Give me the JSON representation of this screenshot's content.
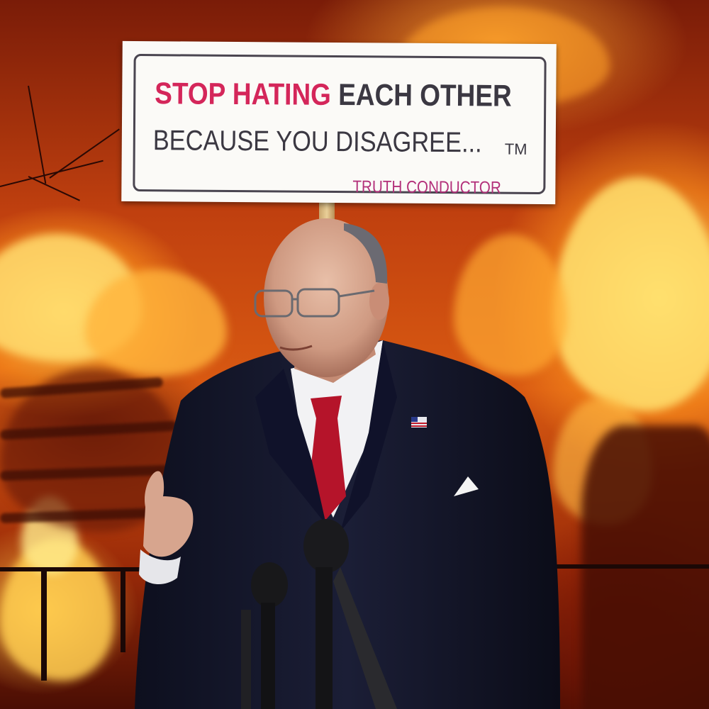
{
  "sign": {
    "line1_part1": "STOP HATING",
    "line1_part2": "EACH OTHER",
    "line2": "BECAUSE YOU DISAGREE...",
    "trademark": "TM",
    "footer": "TRUTH CONDUCTOR"
  },
  "colors": {
    "fire_bright": "#ffd65a",
    "fire_mid": "#d95a12",
    "fire_dark": "#4a0e04",
    "sign_red": "#d4265a",
    "sign_text": "#3b3842",
    "sign_footer": "#b3307a",
    "suit": "#141628",
    "tie": "#b5142a"
  },
  "icons": {
    "lapel_pin": "american-flag-pin-icon"
  }
}
